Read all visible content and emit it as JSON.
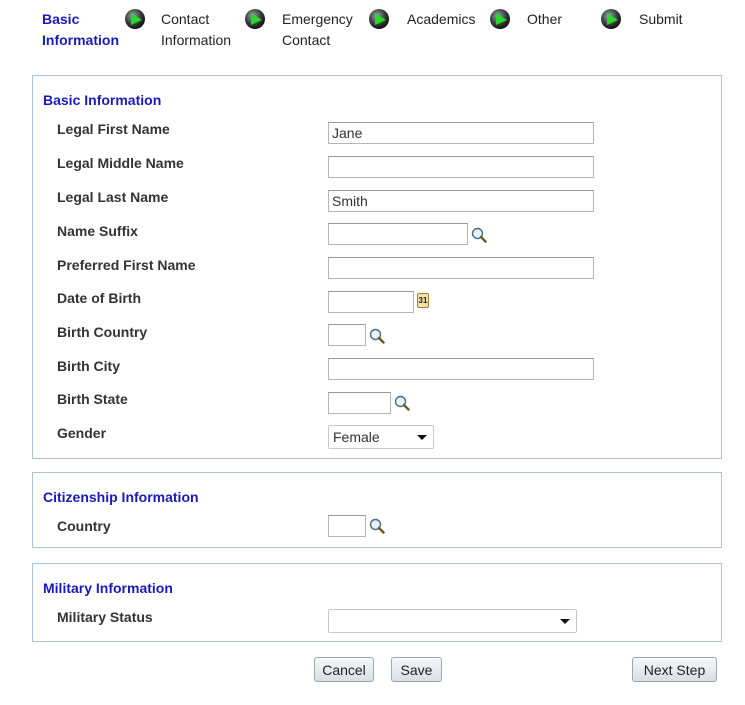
{
  "steps": [
    {
      "line1": "Basic",
      "line2": "Information",
      "active": true
    },
    {
      "line1": "Contact",
      "line2": "Information",
      "active": false
    },
    {
      "line1": "Emergency",
      "line2": "Contact",
      "active": false
    },
    {
      "line1": "Academics",
      "line2": "",
      "active": false
    },
    {
      "line1": "Other",
      "line2": "",
      "active": false
    },
    {
      "line1": "Submit",
      "line2": "",
      "active": false
    }
  ],
  "basic": {
    "title": "Basic Information",
    "fields": {
      "first_name": {
        "label": "Legal First Name",
        "value": "Jane"
      },
      "middle_name": {
        "label": "Legal Middle Name",
        "value": ""
      },
      "last_name": {
        "label": "Legal Last Name",
        "value": "Smith"
      },
      "suffix": {
        "label": "Name Suffix",
        "value": ""
      },
      "preferred": {
        "label": "Preferred First Name",
        "value": ""
      },
      "dob": {
        "label": "Date of Birth",
        "value": ""
      },
      "birth_country": {
        "label": "Birth Country",
        "value": ""
      },
      "birth_city": {
        "label": "Birth City",
        "value": ""
      },
      "birth_state": {
        "label": "Birth State",
        "value": ""
      },
      "gender": {
        "label": "Gender",
        "value": "Female"
      }
    },
    "calendar_day": "31"
  },
  "citizenship": {
    "title": "Citizenship Information",
    "country_label": "Country",
    "country_value": ""
  },
  "military": {
    "title": "Military Information",
    "status_label": "Military Status",
    "status_value": ""
  },
  "buttons": {
    "cancel": "Cancel",
    "save": "Save",
    "next": "Next Step"
  },
  "colors": {
    "accent": "#1a1ab8",
    "border": "#a9c3dd",
    "arrow_green": "#2ecc2e"
  }
}
